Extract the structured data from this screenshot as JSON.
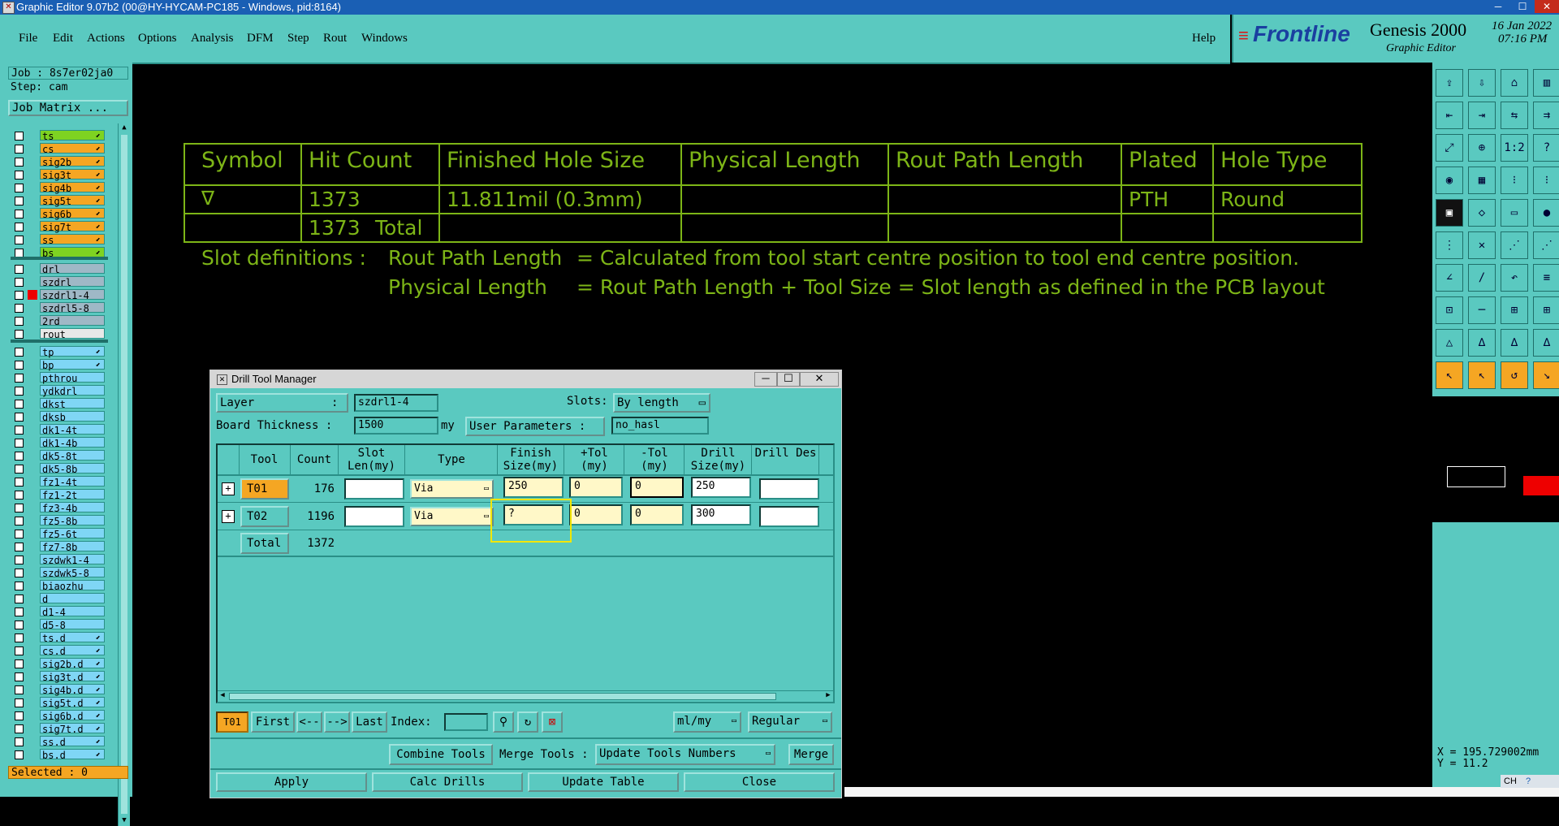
{
  "window": {
    "title": "Graphic Editor 9.07b2 (00@HY-HYCAM-PC185 - Windows, pid:8164)"
  },
  "menu": {
    "items": [
      "File",
      "Edit",
      "Actions",
      "Options",
      "Analysis",
      "DFM",
      "Step",
      "Rout",
      "Windows"
    ],
    "help": "Help"
  },
  "brand": {
    "logo": "Frontline",
    "product": "Genesis 2000",
    "subtitle": "Graphic Editor",
    "date": "16 Jan 2022",
    "time": "07:16 PM"
  },
  "left": {
    "job": "Job : 8s7er02ja0",
    "step": "Step: cam",
    "job_matrix": "Job Matrix ...",
    "selected": "Selected : 0",
    "layers_a": [
      "ts",
      "cs",
      "sig2b",
      "sig3t",
      "sig4b",
      "sig5t",
      "sig6b",
      "sig7t",
      "ss",
      "bs"
    ],
    "layers_b": [
      "drl",
      "szdrl",
      "szdrl1-4",
      "szdrl5-8",
      "2rd",
      "rout"
    ],
    "layers_c": [
      "tp",
      "bp",
      "pthrou",
      "ydkdrl",
      "dkst",
      "dksb",
      "dk1-4t",
      "dk1-4b",
      "dk5-8t",
      "dk5-8b",
      "fz1-4t",
      "fz1-2t",
      "fz3-4b",
      "fz5-8b",
      "fz5-6t",
      "fz7-8b",
      "szdwk1-4",
      "szdwk5-8",
      "biaozhu",
      "d",
      "d1-4",
      "d5-8",
      "ts.d",
      "cs.d",
      "sig2b.d",
      "sig3t.d",
      "sig4b.d",
      "sig5t.d",
      "sig6b.d",
      "sig7t.d",
      "ss.d",
      "bs.d"
    ]
  },
  "canvas": {
    "headers": [
      "Symbol",
      "Hit Count",
      "Finished Hole Size",
      "Physical Length",
      "Rout Path Length",
      "Plated",
      "Hole Type"
    ],
    "row1": {
      "symbol": "∇",
      "hits": "1373",
      "size": "11.811mil (0.3mm)",
      "plated": "PTH",
      "type": "Round"
    },
    "total_count": "1373",
    "total_label": "Total",
    "slot_label": "Slot definitions :",
    "def1_key": "Rout Path Length",
    "def1_val": "= Calculated from tool start centre position to tool end centre position.",
    "def2_key": "Physical Length",
    "def2_val": "= Rout Path Length + Tool Size = Slot length as defined in the PCB layout"
  },
  "dialog": {
    "title": "Drill Tool Manager",
    "layer_label": "Layer",
    "layer_colon": ":",
    "layer_value": "szdrl1-4",
    "slots_label": "Slots:",
    "slots_value": "By length",
    "board_label": "Board Thickness :",
    "board_value": "1500",
    "board_unit": "my",
    "user_params": "User Parameters :",
    "user_value": "no_hasl",
    "columns": [
      "Tool",
      "Count",
      "Slot Len(my)",
      "Type",
      "Finish Size(my)",
      "+Tol (my)",
      "-Tol (my)",
      "Drill Size(my)",
      "Drill Des"
    ],
    "rows": [
      {
        "tool": "T01",
        "count": "176",
        "type": "Via",
        "finish": "250",
        "ptol": "0",
        "mtol": "0",
        "drill": "250"
      },
      {
        "tool": "T02",
        "count": "1196",
        "type": "Via",
        "finish": "?",
        "ptol": "0",
        "mtol": "0",
        "drill": "300"
      }
    ],
    "total_label": "Total",
    "total_count": "1372",
    "nav": {
      "current": "T01",
      "first": "First",
      "prev": "<--",
      "next": "-->",
      "last": "Last",
      "index": "Index:",
      "units": "ml/my",
      "mode": "Regular"
    },
    "actions": {
      "combine": "Combine Tools",
      "merge_label": "Merge Tools :",
      "merge_value": "Update Tools Numbers",
      "merge": "Merge"
    },
    "bottom": [
      "Apply",
      "Calc Drills",
      "Update Table",
      "Close"
    ]
  },
  "status": {
    "x": "X = 195.729002mm",
    "y": "Y = 11.2",
    "ime": "CH"
  }
}
